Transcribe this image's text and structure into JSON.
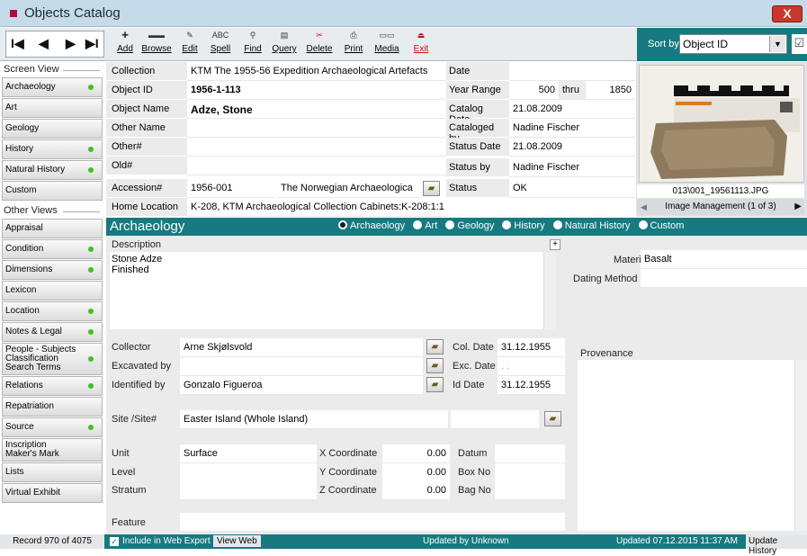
{
  "window": {
    "title": "Objects Catalog",
    "close_label": "X"
  },
  "nav": {
    "first": "I◀",
    "prev": "◀",
    "next": "▶",
    "last": "▶I"
  },
  "toolbar": {
    "add": "Add",
    "browse": "Browse",
    "edit": "Edit",
    "spell": "Spell",
    "find": "Find",
    "query": "Query",
    "delete": "Delete",
    "print": "Print",
    "media": "Media",
    "exit": "Exit"
  },
  "sort": {
    "label": "Sort by",
    "value": "Object ID"
  },
  "screen_view": {
    "title": "Screen View",
    "items": [
      {
        "label": "Archaeology"
      },
      {
        "label": "Art"
      },
      {
        "label": "Geology"
      },
      {
        "label": "History"
      },
      {
        "label": "Natural History"
      },
      {
        "label": "Custom"
      }
    ]
  },
  "other_views": {
    "title": "Other Views",
    "items": [
      {
        "label": "Appraisal"
      },
      {
        "label": "Condition"
      },
      {
        "label": "Dimensions"
      },
      {
        "label": "Lexicon"
      },
      {
        "label": "Location"
      },
      {
        "label": "Notes & Legal"
      },
      {
        "label": "People - Subjects Classification Search Terms"
      },
      {
        "label": "Relations"
      },
      {
        "label": "Repatriation"
      },
      {
        "label": "Source"
      },
      {
        "label": "Inscription Maker's Mark"
      },
      {
        "label": "Lists"
      },
      {
        "label": "Virtual Exhibit"
      }
    ]
  },
  "header": {
    "collection_label": "Collection",
    "collection": "KTM The 1955-56 Expedition Archaeological Artefacts",
    "object_id_label": "Object ID",
    "object_id": "1956-1-113",
    "object_name_label": "Object Name",
    "object_name": "Adze, Stone",
    "other_name_label": "Other Name",
    "other_name": "",
    "other_num_label": "Other#",
    "other_num": "",
    "old_num_label": "Old#",
    "old_num": "",
    "accession_label": "Accession#",
    "accession": "1956-001",
    "accession_name": "The Norwegian Archaeologica",
    "home_location_label": "Home Location",
    "home_location": "K-208, KTM Archaeological Collection Cabinets:K-208:1:1",
    "date_label": "Date",
    "date": "",
    "year_range_label": "Year Range",
    "year_from": "500",
    "thru_label": "thru",
    "year_to": "1850",
    "catalog_date_label": "Catalog Date",
    "catalog_date": "21.08.2009",
    "cataloged_by_label": "Cataloged by",
    "cataloged_by": "Nadine Fischer",
    "status_date_label": "Status Date",
    "status_date": "21.08.2009",
    "status_by_label": "Status by",
    "status_by": "Nadine Fischer",
    "status_label": "Status",
    "status": "OK"
  },
  "image": {
    "filename": "013\\001_19561113.JPG",
    "management": "Image Management (1 of 3)"
  },
  "section": {
    "title": "Archaeology",
    "radios": [
      "Archaeology",
      "Art",
      "Geology",
      "History",
      "Natural History",
      "Custom"
    ]
  },
  "detail": {
    "description_label": "Description",
    "description_line1": "Stone Adze",
    "description_line2": "Finished",
    "material_label": "Material",
    "material": "Basalt",
    "dating_method_label": "Dating Method",
    "dating_method": "",
    "collector_label": "Collector",
    "collector": "Arne Skjølsvold",
    "col_date_label": "Col. Date",
    "col_date": "31.12.1955",
    "excavated_by_label": "Excavated by",
    "excavated_by": "",
    "exc_date_label": "Exc. Date",
    "exc_date": ". .",
    "identified_by_label": "Identified by",
    "identified_by": "Gonzalo Figueroa",
    "id_date_label": "Id Date",
    "id_date": "31.12.1955",
    "provenance_label": "Provenance",
    "site_label": "Site /Site#",
    "site": "Easter Island (Whole Island)",
    "site_num": "",
    "unit_label": "Unit",
    "unit": "Surface",
    "level_label": "Level",
    "level": "",
    "stratum_label": "Stratum",
    "stratum": "",
    "xcoord_label": "X Coordinate",
    "xcoord": "0.00",
    "ycoord_label": "Y Coordinate",
    "ycoord": "0.00",
    "zcoord_label": "Z Coordinate",
    "zcoord": "0.00",
    "datum_label": "Datum",
    "datum": "",
    "boxno_label": "Box No",
    "boxno": "",
    "bagno_label": "Bag No",
    "bagno": "",
    "feature_label": "Feature",
    "feature": ""
  },
  "status_bar": {
    "record": "Record 970 of 4075",
    "web_export_label": "Include in Web Export",
    "view_web": "View Web",
    "updated_by": "Updated by  Unknown",
    "updated": "Updated   07.12.2015 11:37 AM",
    "update_history": "Update History"
  },
  "colors": {
    "accent": "#177a80",
    "dot": "#3fc11f",
    "exit": "#c0101e",
    "title_square": "#b00e3a"
  }
}
